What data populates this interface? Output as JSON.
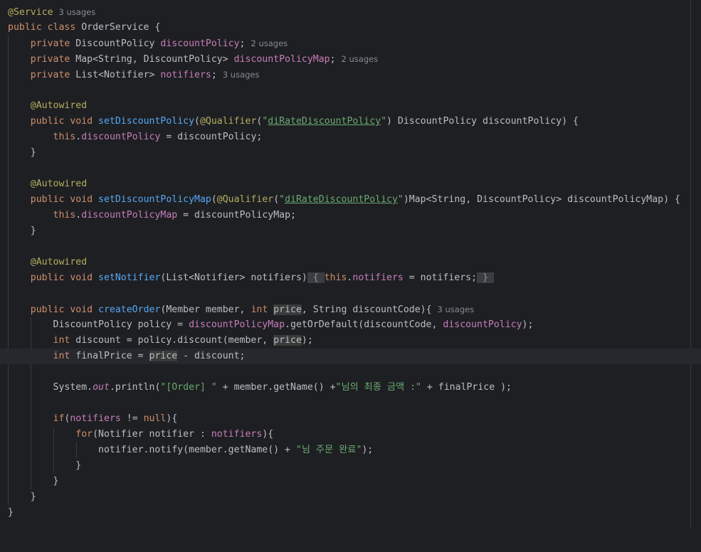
{
  "usages": {
    "class": "3 usages",
    "discount_policy": "2 usages",
    "discount_policy_map": "2 usages",
    "notifiers": "3 usages",
    "create_order": "3 usages"
  },
  "code": {
    "service_annotation": "@Service",
    "autowired": "@Autowired",
    "qualifier": "@Qualifier",
    "qualifier_value": "diRateDiscountPolicy",
    "class_name": "OrderService",
    "field_discount_policy": "discountPolicy",
    "field_discount_policy_map": "discountPolicyMap",
    "field_notifiers": "notifiers",
    "method_set_discount_policy": "setDiscountPolicy",
    "method_set_discount_policy_map": "setDiscountPolicyMap",
    "method_set_notifier": "setNotifier",
    "method_create_order": "createOrder",
    "print_prefix": "\"[Order] \"",
    "print_message": "\"님의 최종 금액 :\"",
    "notify_message": "\"님 주문 완료\"",
    "out": "out"
  }
}
